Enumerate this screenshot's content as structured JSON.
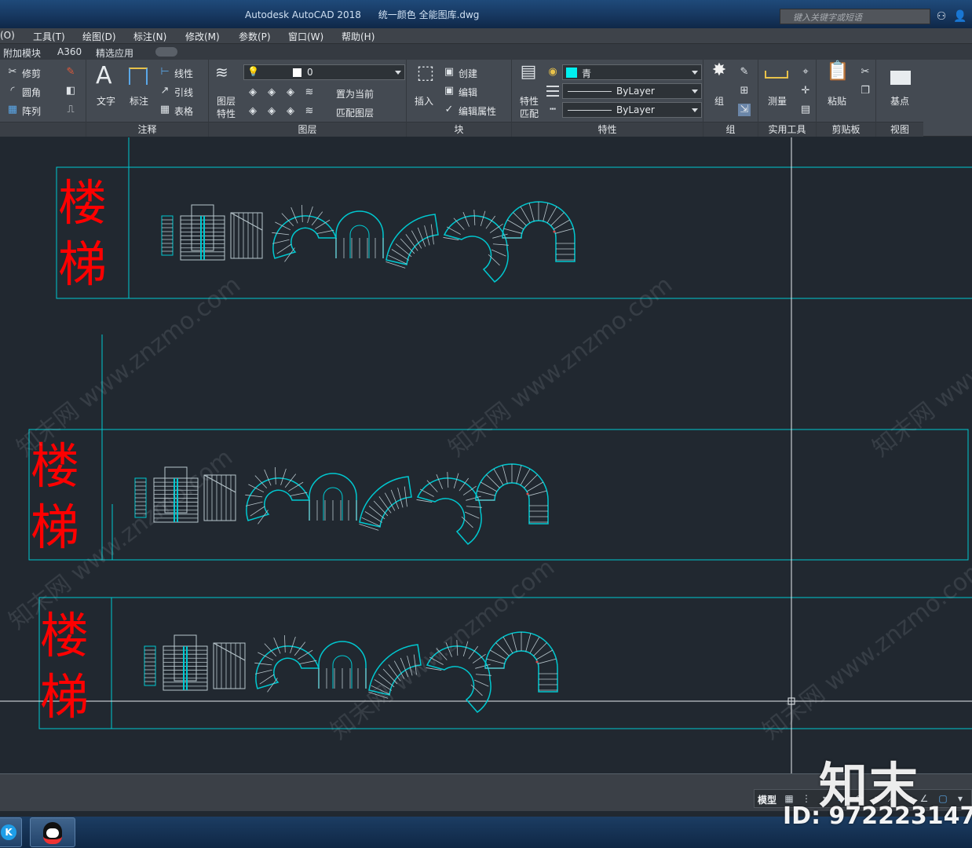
{
  "window": {
    "app_title": "Autodesk AutoCAD 2018",
    "file_name": "统一颜色 全能图库.dwg",
    "search_placeholder": "键入关键字或短语"
  },
  "menu": [
    "(O)",
    "工具(T)",
    "绘图(D)",
    "标注(N)",
    "修改(M)",
    "参数(P)",
    "窗口(W)",
    "帮助(H)"
  ],
  "ribbon_tabs": [
    "附加模块",
    "A360",
    "精选应用"
  ],
  "ribbon": {
    "modify": {
      "trim": "修剪",
      "fillet": "圆角",
      "array": "阵列"
    },
    "annotate": {
      "text": "文字",
      "dimension": "标注",
      "linear": "线性",
      "leader": "引线",
      "table": "表格",
      "footer": "注释"
    },
    "layers": {
      "layer_props": "图层\n特性",
      "layer_props_l1": "图层",
      "layer_props_l2": "特性",
      "current_layer": "0",
      "set_current": "置为当前",
      "match_layer": "匹配图层",
      "footer": "图层"
    },
    "block": {
      "insert": "插入",
      "create": "创建",
      "edit": "编辑",
      "edit_attr": "编辑属性",
      "footer": "块"
    },
    "properties": {
      "match_l1": "特性",
      "match_l2": "匹配",
      "color": "青",
      "linetype": "ByLayer",
      "lineweight": "ByLayer",
      "footer": "特性"
    },
    "groups": {
      "group": "组",
      "footer": "组"
    },
    "utilities": {
      "measure": "测量",
      "footer": "实用工具"
    },
    "clipboard": {
      "paste": "粘贴",
      "footer": "剪贴板"
    },
    "view": {
      "base": "基点",
      "footer": "视图"
    }
  },
  "colors": {
    "cad_bg": "#212830",
    "frame": "#00c8d0",
    "label": "#ff0000",
    "stair": "#b8c6cc"
  },
  "drawing": {
    "blocks": [
      {
        "label_1": "楼",
        "label_2": "梯"
      },
      {
        "label_1": "楼",
        "label_2": "梯"
      },
      {
        "label_1": "楼",
        "label_2": "梯"
      }
    ]
  },
  "watermark": "知末网 www.znzmo.com",
  "status_bar": {
    "model": "模型"
  },
  "overlay": {
    "brand": "知末",
    "id_text": "ID: 972223147"
  }
}
